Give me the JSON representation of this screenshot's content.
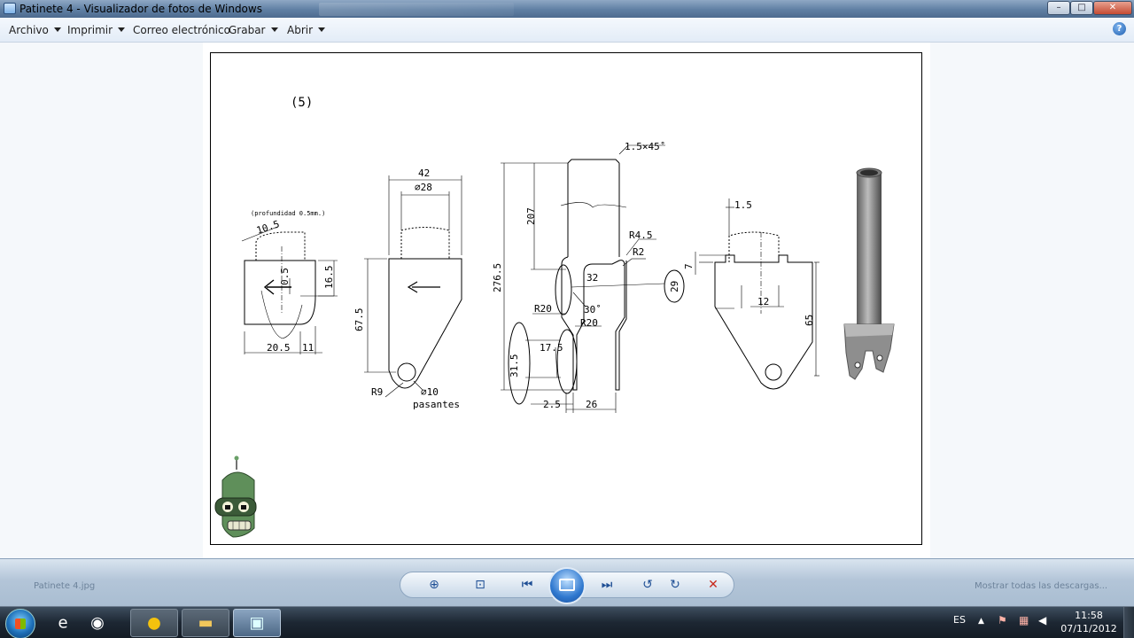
{
  "window": {
    "title": "Patinete 4 - Visualizador de fotos de Windows",
    "controls": {
      "minimize": "–",
      "maximize": "□",
      "close": "✕"
    }
  },
  "menu": {
    "items": [
      {
        "label": "Archivo",
        "has_dropdown": true
      },
      {
        "label": "Imprimir",
        "has_dropdown": true
      },
      {
        "label": "Correo electrónico",
        "has_dropdown": false
      },
      {
        "label": "Grabar",
        "has_dropdown": true
      },
      {
        "label": "Abrir",
        "has_dropdown": true
      }
    ],
    "help_glyph": "?"
  },
  "drawing": {
    "view_number": "(5)",
    "dimensions": {
      "left_depth_note": "(profundidad 0.5mm.)",
      "left_10_5": "10.5",
      "left_0_5": "0.5",
      "left_16_5": "16.5",
      "left_20_5": "20.5",
      "left_11": "11",
      "front_42": "42",
      "front_diam28": "⌀28",
      "front_67_5": "67.5",
      "front_r9": "R9",
      "front_diam10": "⌀10",
      "front_pasantes": "pasantes",
      "side_chamfer": "1.5×45˚",
      "side_207": "207",
      "side_276_5": "276.5",
      "side_r4_5": "R4.5",
      "side_r2": "R2",
      "side_32": "32",
      "side_29": "29",
      "side_r20_a": "R20",
      "side_30deg": "30˚",
      "side_r20_b": "R20",
      "side_31_5": "31.5",
      "side_17_5": "17.5",
      "side_2_5": "2.5",
      "side_26": "26",
      "right_1_5": "1.5",
      "right_7": "7",
      "right_12": "12",
      "right_65": "65"
    }
  },
  "controlbar": {
    "ghost_left": "Patinete 4.jpg",
    "ghost_right": "Mostrar todas las descargas...",
    "buttons": {
      "zoom": "⊕",
      "fit": "⊡",
      "prev": "⏮",
      "next": "⏭",
      "rotate_left": "↺",
      "rotate_right": "↻",
      "delete": "✕"
    }
  },
  "taskbar": {
    "language": "ES",
    "time": "11:58",
    "date": "07/11/2012"
  }
}
